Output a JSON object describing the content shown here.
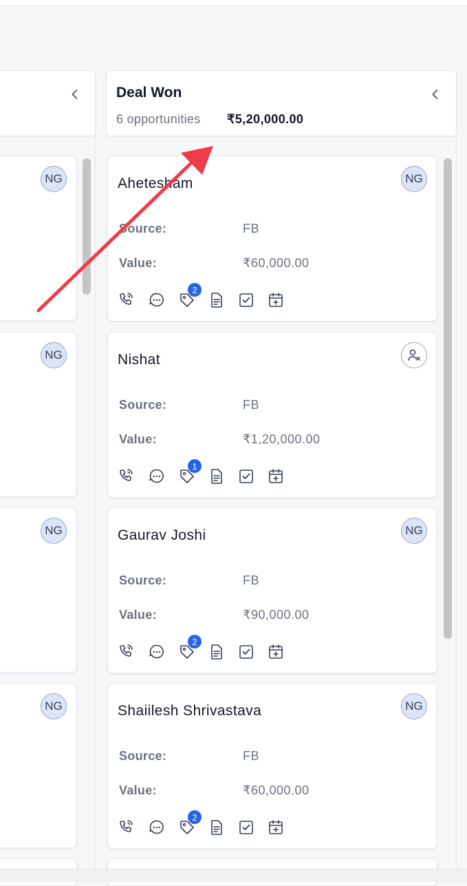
{
  "left_column": {
    "avatar_initials": [
      "NG",
      "NG",
      "NG",
      "NG"
    ]
  },
  "deal_won": {
    "title": "Deal Won",
    "opportunities": "6 opportunities",
    "total": "₹5,20,000.00",
    "cards": [
      {
        "name": "Ahetesham",
        "source_label": "Source:",
        "source": "FB",
        "value_label": "Value:",
        "value": "₹60,000.00",
        "avatar": "NG",
        "tag_count": "2"
      },
      {
        "name": "Nishat",
        "source_label": "Source:",
        "source": "FB",
        "value_label": "Value:",
        "value": "₹1,20,000.00",
        "avatar": "",
        "tag_count": "1"
      },
      {
        "name": "Gaurav Joshi",
        "source_label": "Source:",
        "source": "FB",
        "value_label": "Value:",
        "value": "₹90,000.00",
        "avatar": "NG",
        "tag_count": "2"
      },
      {
        "name": "Shaiilesh Shrivastava",
        "source_label": "Source:",
        "source": "FB",
        "value_label": "Value:",
        "value": "₹60,000.00",
        "avatar": "NG",
        "tag_count": "2"
      }
    ]
  },
  "icons": {
    "chevron": "chevron-left-icon",
    "call": "phone-call-icon",
    "message": "message-dots-icon",
    "tag": "tag-icon",
    "note": "document-icon",
    "task": "checkbox-icon",
    "event": "calendar-add-icon",
    "unassigned": "user-remove-icon"
  },
  "colors": {
    "badge": "#2563eb",
    "arrow": "#ef3b4a",
    "avatar_bg": "#dbe5f7"
  }
}
